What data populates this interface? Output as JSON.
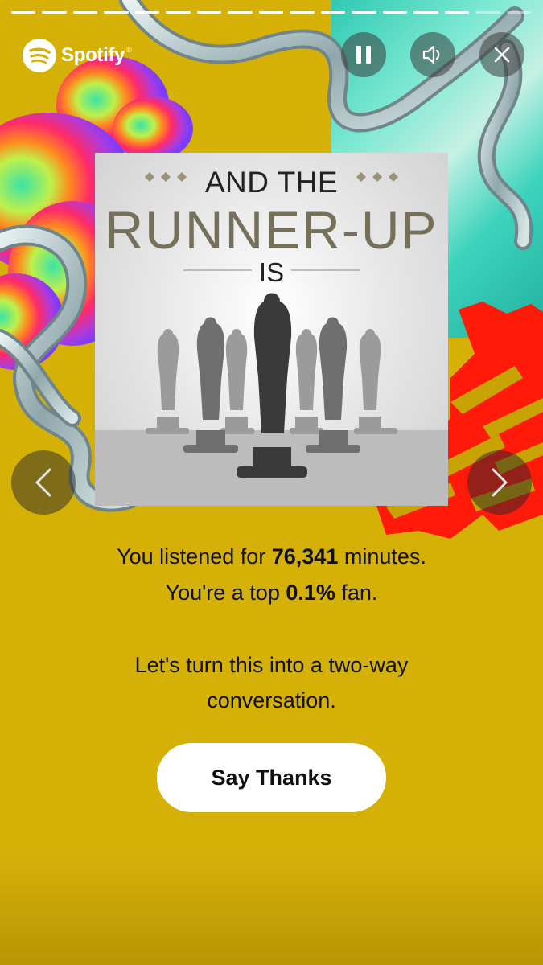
{
  "app": {
    "brand": "Spotify",
    "trademark": "®"
  },
  "progress": {
    "total_segments": 17,
    "completed_segments": 15
  },
  "header": {
    "pause_icon": "pause-icon",
    "volume_icon": "volume-icon",
    "close_icon": "close-icon"
  },
  "navigation": {
    "prev_icon": "chevron-left-icon",
    "next_icon": "chevron-right-icon"
  },
  "cover": {
    "line1": "AND THE",
    "line2": "RUNNER-UP",
    "line3": "IS"
  },
  "stats": {
    "line1_prefix": "You listened for ",
    "minutes": "76,341",
    "line1_suffix": " minutes.",
    "line2_prefix": "You're a top ",
    "percent": "0.1%",
    "line2_suffix": " fan."
  },
  "message": {
    "line1": "Let's turn this into a two-way",
    "line2": "conversation."
  },
  "cta": {
    "label": "Say Thanks"
  },
  "colors": {
    "background": "#d5b108",
    "accent_red": "#ff1a0a",
    "teal": "#2fc9b2",
    "button_bg": "#ffffff"
  }
}
